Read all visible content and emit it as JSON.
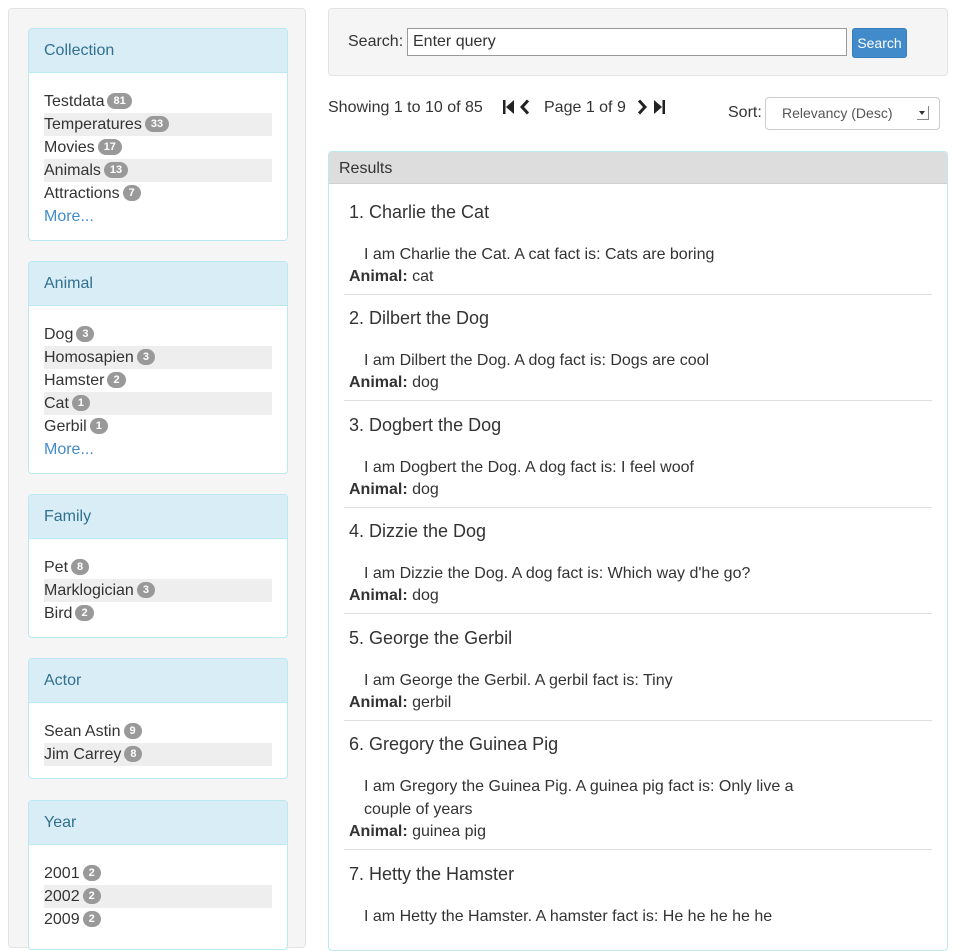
{
  "sidebar": {
    "facets": [
      {
        "title": "Collection",
        "items": [
          {
            "label": "Testdata",
            "count": "81"
          },
          {
            "label": "Temperatures",
            "count": "33"
          },
          {
            "label": "Movies",
            "count": "17"
          },
          {
            "label": "Animals",
            "count": "13"
          },
          {
            "label": "Attractions",
            "count": "7"
          }
        ],
        "more": "More..."
      },
      {
        "title": "Animal",
        "items": [
          {
            "label": "Dog",
            "count": "3"
          },
          {
            "label": "Homosapien",
            "count": "3"
          },
          {
            "label": "Hamster",
            "count": "2"
          },
          {
            "label": "Cat",
            "count": "1"
          },
          {
            "label": "Gerbil",
            "count": "1"
          }
        ],
        "more": "More..."
      },
      {
        "title": "Family",
        "items": [
          {
            "label": "Pet",
            "count": "8"
          },
          {
            "label": "Marklogician",
            "count": "3"
          },
          {
            "label": "Bird",
            "count": "2"
          }
        ]
      },
      {
        "title": "Actor",
        "items": [
          {
            "label": "Sean Astin",
            "count": "9"
          },
          {
            "label": "Jim Carrey",
            "count": "8"
          }
        ]
      },
      {
        "title": "Year",
        "items": [
          {
            "label": "2001",
            "count": "2"
          },
          {
            "label": "2002",
            "count": "2"
          },
          {
            "label": "2009",
            "count": "2"
          }
        ]
      }
    ]
  },
  "search": {
    "label": "Search:",
    "placeholder": "Enter query",
    "button": "Search"
  },
  "pager": {
    "showing": "Showing 1 to 10 of 85",
    "page": "Page 1 of 9",
    "sort_label": "Sort:",
    "sort_value": "Relevancy (Desc)"
  },
  "results": {
    "header": "Results",
    "field_label": "Animal:",
    "items": [
      {
        "title": "1. Charlie the Cat",
        "snippet": "I am Charlie the Cat. A cat fact is: Cats are boring",
        "animal": "cat"
      },
      {
        "title": "2. Dilbert the Dog",
        "snippet": "I am Dilbert the Dog. A dog fact is: Dogs are cool",
        "animal": "dog"
      },
      {
        "title": "3. Dogbert the Dog",
        "snippet": "I am Dogbert the Dog. A dog fact is: I feel woof",
        "animal": "dog"
      },
      {
        "title": "4. Dizzie the Dog",
        "snippet": "I am Dizzie the Dog. A dog fact is: Which way d'he go?",
        "animal": "dog"
      },
      {
        "title": "5. George the Gerbil",
        "snippet": "I am George the Gerbil. A gerbil fact is: Tiny",
        "animal": "gerbil"
      },
      {
        "title": "6. Gregory the Guinea Pig",
        "snippet": "I am Gregory the Guinea Pig. A guinea pig fact is: Only live a couple of years",
        "animal": "guinea pig"
      },
      {
        "title": "7. Hetty the Hamster",
        "snippet": "I am Hetty the Hamster. A hamster fact is: He he he he he",
        "animal": ""
      }
    ]
  }
}
